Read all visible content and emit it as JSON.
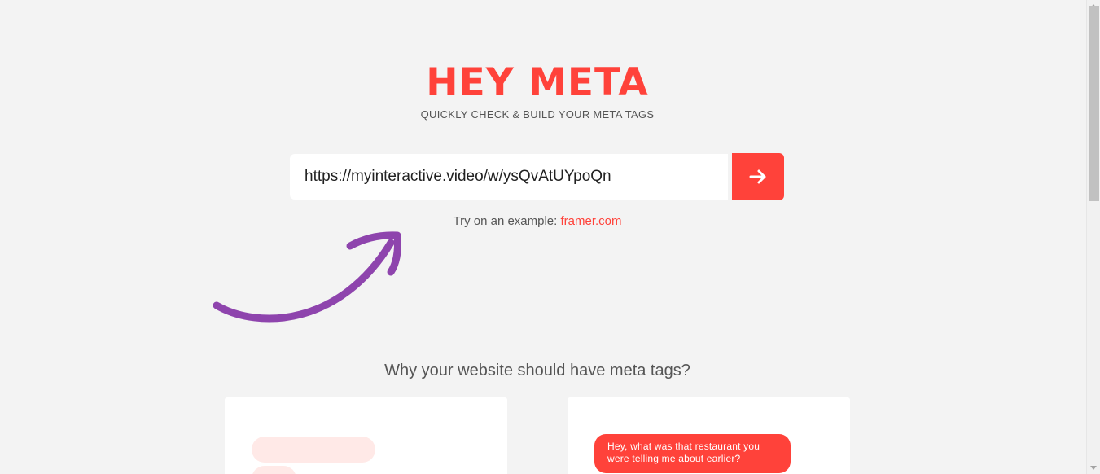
{
  "header": {
    "logo": "HEY META",
    "tagline": "QUICKLY CHECK & BUILD YOUR META TAGS"
  },
  "search": {
    "value": "https://myinteractive.video/w/ysQvAtUYpoQn",
    "submit_icon": "arrow-right-icon"
  },
  "example": {
    "prefix": "Try on an example:",
    "link": "framer.com"
  },
  "section": {
    "title": "Why your website should have meta tags?"
  },
  "cards": {
    "right": {
      "chat_message": "Hey, what was that restaurant you were telling me about earlier?"
    }
  },
  "colors": {
    "accent": "#ff423a",
    "background": "#f3f3f3",
    "decoration_arrow": "#8e44ad",
    "pill": "#ffe9e7"
  }
}
